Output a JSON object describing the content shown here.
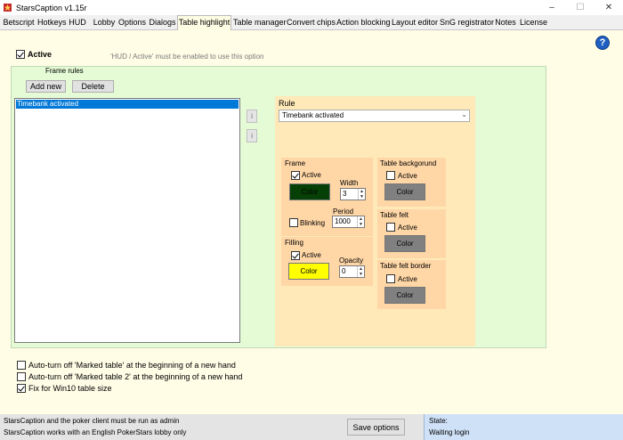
{
  "window": {
    "title": "StarsCaption v1.15r"
  },
  "menu": {
    "tabs": [
      "Betscript",
      "Hotkeys",
      "HUD",
      "Lobby",
      "Options",
      "Dialogs",
      "Table highlight",
      "Table manager",
      "Convert chips",
      "Action blocking",
      "Layout editor",
      "SnG registrator",
      "Notes",
      "License"
    ],
    "active_tab": "Table highlight"
  },
  "main": {
    "active_label": "Active",
    "active_checked": true,
    "active_hint": "'HUD / Active' must be enabled to use this option",
    "frame_rules_label": "Frame rules",
    "add_new_label": "Add new",
    "delete_label": "Delete",
    "rules_list": [
      "Timebank activated"
    ],
    "rule_label": "Rule",
    "rule_selected": "Timebank activated",
    "frame": {
      "title": "Frame",
      "active_label": "Active",
      "active_checked": true,
      "color_label": "Color",
      "color_hex": "#064006",
      "width_label": "Width",
      "width_value": "3",
      "blinking_label": "Blinking",
      "blinking_checked": false,
      "period_label": "Period",
      "period_value": "1000"
    },
    "filling": {
      "title": "Filling",
      "active_label": "Active",
      "active_checked": true,
      "color_label": "Color",
      "color_hex": "#ffff00",
      "opacity_label": "Opacity",
      "opacity_value": "0"
    },
    "table_background": {
      "title": "Table backgorund",
      "active_label": "Active",
      "active_checked": false,
      "color_label": "Color",
      "color_hex": "#808080"
    },
    "table_felt": {
      "title": "Table felt",
      "active_label": "Active",
      "active_checked": false,
      "color_label": "Color",
      "color_hex": "#808080"
    },
    "table_felt_border": {
      "title": "Table felt border",
      "active_label": "Active",
      "active_checked": false,
      "color_label": "Color",
      "color_hex": "#808080"
    },
    "options": [
      {
        "label": "Auto-turn off 'Marked table' at the beginning of a new hand",
        "checked": false
      },
      {
        "label": "Auto-turn off 'Marked table 2' at the beginning of a new hand",
        "checked": false
      },
      {
        "label": "Fix for Win10 table size",
        "checked": true
      }
    ]
  },
  "status": {
    "line1": "StarsCaption and the poker client must be run as admin",
    "line2": "StarsCaption works with an English PokerStars lobby only",
    "save_label": "Save options",
    "state_label": "State:",
    "state_value": "Waiting login"
  },
  "icons": {
    "help": "?",
    "minimize": "–",
    "maximize": "☐",
    "close": "✕",
    "dropdown": "⌄",
    "spin_up": "▲",
    "spin_down": "▼",
    "move_up": "i",
    "move_down": "i"
  }
}
